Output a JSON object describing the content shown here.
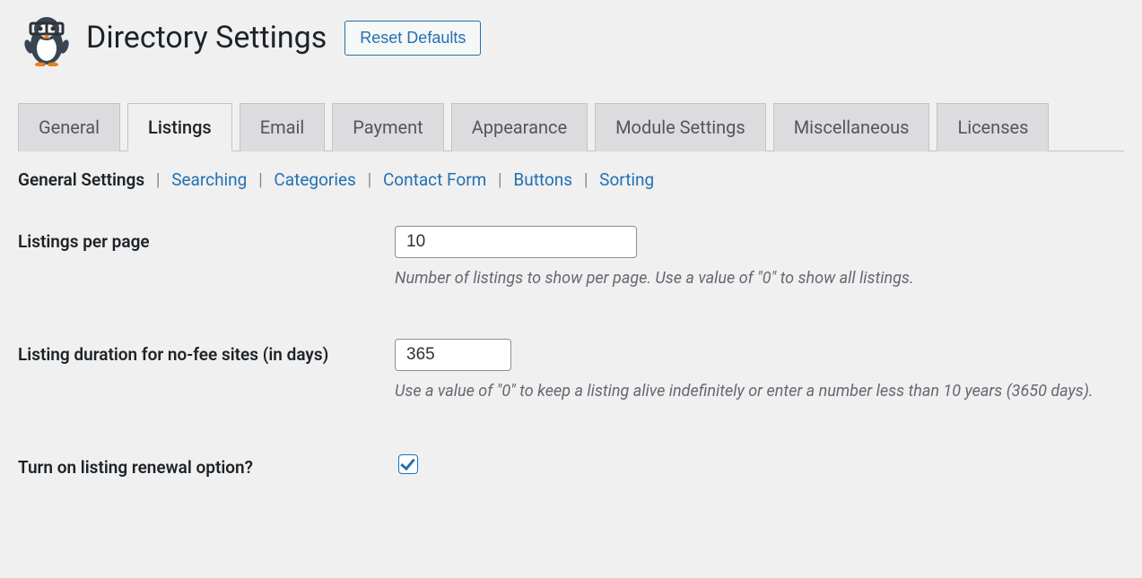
{
  "header": {
    "title": "Directory Settings",
    "reset_button": "Reset Defaults"
  },
  "tabs": {
    "general": "General",
    "listings": "Listings",
    "email": "Email",
    "payment": "Payment",
    "appearance": "Appearance",
    "module": "Module Settings",
    "misc": "Miscellaneous",
    "licenses": "Licenses"
  },
  "subtabs": {
    "general_settings": "General Settings",
    "searching": "Searching",
    "categories": "Categories",
    "contact_form": "Contact Form",
    "buttons": "Buttons",
    "sorting": "Sorting"
  },
  "fields": {
    "listings_per_page": {
      "label": "Listings per page",
      "value": "10",
      "description": "Number of listings to show per page. Use a value of \"0\" to show all listings."
    },
    "listing_duration": {
      "label": "Listing duration for no-fee sites (in days)",
      "value": "365",
      "description": "Use a value of \"0\" to keep a listing alive indefinitely or enter a number less than 10 years (3650 days)."
    },
    "renewal_option": {
      "label": "Turn on listing renewal option?",
      "checked": true
    }
  }
}
